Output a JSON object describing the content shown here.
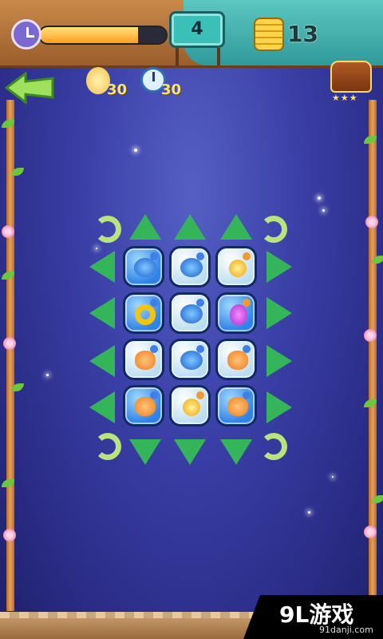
{
  "hud": {
    "level": "4",
    "coins": "13",
    "timer_progress": 0.78,
    "hint_count": "30",
    "time_bonus_count": "30",
    "chest_stars": "★★★"
  },
  "board": {
    "rows": [
      [
        "blue-drop",
        "blue-drop",
        "yellow"
      ],
      [
        "ring",
        "blue-drop",
        "purple"
      ],
      [
        "flower-o",
        "blue-drop",
        "flower-o"
      ],
      [
        "flower-o",
        "yellow",
        "flower-o"
      ]
    ],
    "tile_style": [
      [
        "blue",
        "light",
        "light"
      ],
      [
        "blue",
        "light",
        "blue"
      ],
      [
        "light",
        "light",
        "light"
      ],
      [
        "blue",
        "light",
        "blue"
      ]
    ]
  },
  "watermark": {
    "main": "9L游戏",
    "sub": "91danji.com"
  },
  "colors": {
    "arrow": "#35b55a",
    "wood": "#c98a4a",
    "teal": "#3cbfb7"
  }
}
